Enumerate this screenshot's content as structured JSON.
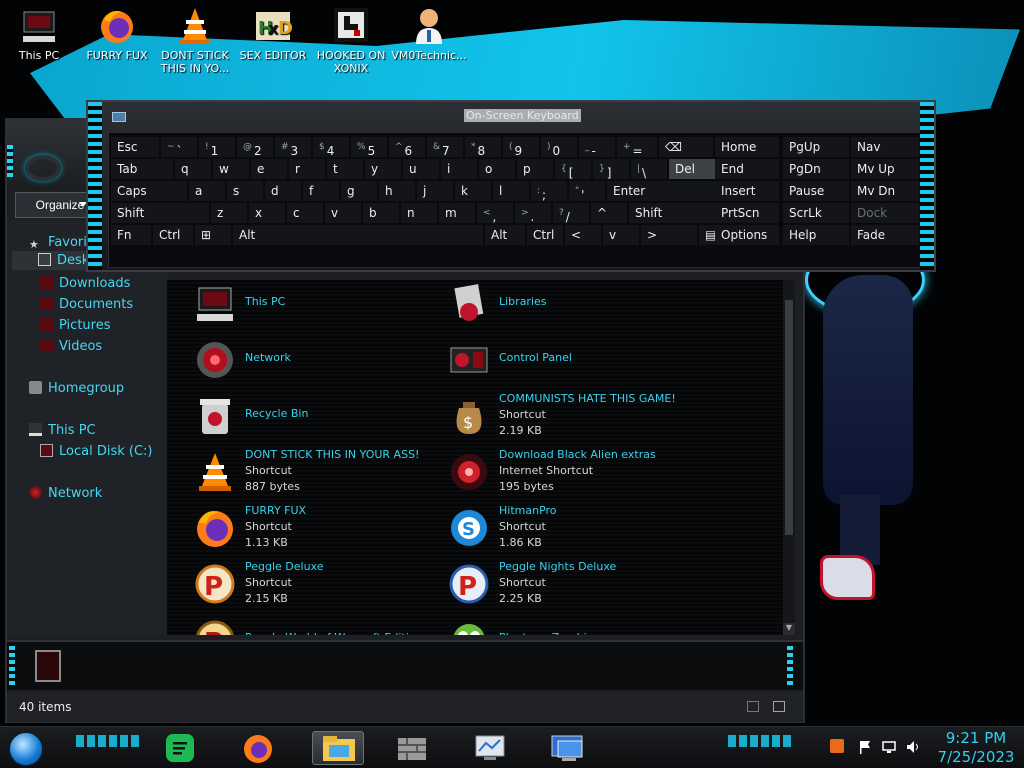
{
  "desktop_icons": [
    {
      "label": "This PC",
      "icon": "computer-icon"
    },
    {
      "label": "FURRY FUX",
      "icon": "firefox-icon"
    },
    {
      "label": "DONT STICK THIS IN YO...",
      "icon": "vlc-cone-icon"
    },
    {
      "label": "SEX EDITOR",
      "icon": "hxd-editor-icon"
    },
    {
      "label": "HOOKED ON XONIX",
      "icon": "xonix-game-icon"
    },
    {
      "label": "VM0Technic...",
      "icon": "doctor-avatar-icon"
    }
  ],
  "osk": {
    "title": "On-Screen Keyboard",
    "rows": [
      [
        {
          "l": "Esc"
        },
        {
          "s": "~",
          "l": "`"
        },
        {
          "s": "!",
          "l": "1"
        },
        {
          "s": "@",
          "l": "2"
        },
        {
          "s": "#",
          "l": "3"
        },
        {
          "s": "$",
          "l": "4"
        },
        {
          "s": "%",
          "l": "5"
        },
        {
          "s": "^",
          "l": "6"
        },
        {
          "s": "&",
          "l": "7"
        },
        {
          "s": "*",
          "l": "8"
        },
        {
          "s": "(",
          "l": "9"
        },
        {
          "s": ")",
          "l": "0"
        },
        {
          "s": "_",
          "l": "-"
        },
        {
          "s": "+",
          "l": "="
        },
        {
          "l": "⌫"
        }
      ],
      [
        {
          "l": "Tab"
        },
        {
          "l": "q"
        },
        {
          "l": "w"
        },
        {
          "l": "e"
        },
        {
          "l": "r"
        },
        {
          "l": "t"
        },
        {
          "l": "y"
        },
        {
          "l": "u"
        },
        {
          "l": "i"
        },
        {
          "l": "o"
        },
        {
          "l": "p"
        },
        {
          "s": "{",
          "l": "["
        },
        {
          "s": "}",
          "l": "]"
        },
        {
          "s": "|",
          "l": "\\"
        },
        {
          "l": "Del"
        }
      ],
      [
        {
          "l": "Caps"
        },
        {
          "l": "a"
        },
        {
          "l": "s"
        },
        {
          "l": "d"
        },
        {
          "l": "f"
        },
        {
          "l": "g"
        },
        {
          "l": "h"
        },
        {
          "l": "j"
        },
        {
          "l": "k"
        },
        {
          "l": "l"
        },
        {
          "s": ":",
          "l": ";"
        },
        {
          "s": "\"",
          "l": "'"
        },
        {
          "l": "Enter"
        }
      ],
      [
        {
          "l": "Shift"
        },
        {
          "l": "z"
        },
        {
          "l": "x"
        },
        {
          "l": "c"
        },
        {
          "l": "v"
        },
        {
          "l": "b"
        },
        {
          "l": "n"
        },
        {
          "l": "m"
        },
        {
          "s": "<",
          "l": ","
        },
        {
          "s": ">",
          "l": "."
        },
        {
          "s": "?",
          "l": "/"
        },
        {
          "l": "^"
        },
        {
          "l": "Shift"
        }
      ],
      [
        {
          "l": "Fn"
        },
        {
          "l": "Ctrl"
        },
        {
          "l": "⊞"
        },
        {
          "l": "Alt"
        },
        {
          "l": "Alt"
        },
        {
          "l": "Ctrl"
        },
        {
          "l": "<"
        },
        {
          "l": "v"
        },
        {
          "l": ">"
        },
        {
          "l": "▤"
        }
      ]
    ],
    "nav_keys": [
      [
        "Home",
        "PgUp",
        "Nav"
      ],
      [
        "End",
        "PgDn",
        "Mv Up"
      ],
      [
        "Insert",
        "Pause",
        "Mv Dn"
      ],
      [
        "PrtScn",
        "ScrLk",
        "Dock"
      ],
      [
        "Options",
        "Help",
        "Fade"
      ]
    ]
  },
  "explorer": {
    "organize_label": "Organize",
    "nav": [
      {
        "label": "Favorites",
        "icon": "star-icon"
      },
      {
        "label": "Desktop",
        "icon": "desktop-folder-icon"
      },
      {
        "label": "Downloads",
        "icon": "downloads-folder-icon"
      },
      {
        "label": "Documents",
        "icon": "documents-folder-icon"
      },
      {
        "label": "Pictures",
        "icon": "pictures-folder-icon"
      },
      {
        "label": "Videos",
        "icon": "videos-folder-icon"
      },
      {
        "label": "Homegroup",
        "icon": "homegroup-icon"
      },
      {
        "label": "This PC",
        "icon": "computer-icon"
      },
      {
        "label": "Local Disk (C:)",
        "icon": "drive-icon"
      },
      {
        "label": "Network",
        "icon": "network-icon"
      }
    ],
    "items": [
      {
        "name": "This PC",
        "type": "",
        "size": "",
        "icon": "computer-icon"
      },
      {
        "name": "Libraries",
        "type": "",
        "size": "",
        "icon": "libraries-icon"
      },
      {
        "name": "Network",
        "type": "",
        "size": "",
        "icon": "network-orb-icon"
      },
      {
        "name": "Control Panel",
        "type": "",
        "size": "",
        "icon": "control-panel-icon"
      },
      {
        "name": "Recycle Bin",
        "type": "",
        "size": "",
        "icon": "recycle-bin-icon"
      },
      {
        "name": "COMMUNISTS HATE THIS GAME!",
        "type": "Shortcut",
        "size": "2.19 KB",
        "icon": "money-bag-icon"
      },
      {
        "name": "DONT STICK THIS IN YOUR ASS!",
        "type": "Shortcut",
        "size": "887 bytes",
        "icon": "vlc-cone-icon"
      },
      {
        "name": "Download Black Alien extras",
        "type": "Internet Shortcut",
        "size": "195 bytes",
        "icon": "alien-orb-icon"
      },
      {
        "name": "FURRY FUX",
        "type": "Shortcut",
        "size": "1.13 KB",
        "icon": "firefox-icon"
      },
      {
        "name": "HitmanPro",
        "type": "Shortcut",
        "size": "1.86 KB",
        "icon": "hitmanpro-icon"
      },
      {
        "name": "Peggle Deluxe",
        "type": "Shortcut",
        "size": "2.15 KB",
        "icon": "peggle-icon"
      },
      {
        "name": "Peggle Nights Deluxe",
        "type": "Shortcut",
        "size": "2.25 KB",
        "icon": "peggle-nights-icon"
      },
      {
        "name": "Peggle World of Warcraft Edition",
        "type": "",
        "size": "",
        "icon": "peggle-wow-icon"
      },
      {
        "name": "Plants vs Zombies",
        "type": "",
        "size": "",
        "icon": "plants-vs-zombies-icon"
      }
    ],
    "status": "40 items"
  },
  "taskbar": {
    "apps": [
      "spotify-icon",
      "firefox-icon",
      "file-explorer-icon",
      "firewall-icon",
      "monitor-icon",
      "remote-desktop-icon"
    ],
    "tray": [
      "fire-icon",
      "flag-icon",
      "network-icon",
      "volume-icon"
    ],
    "time": "9:21 PM",
    "date": "7/25/2023"
  },
  "colors": {
    "accent": "#27d4f0",
    "file_name": "#38d3ef",
    "wallpaper": "#12c4ea"
  }
}
